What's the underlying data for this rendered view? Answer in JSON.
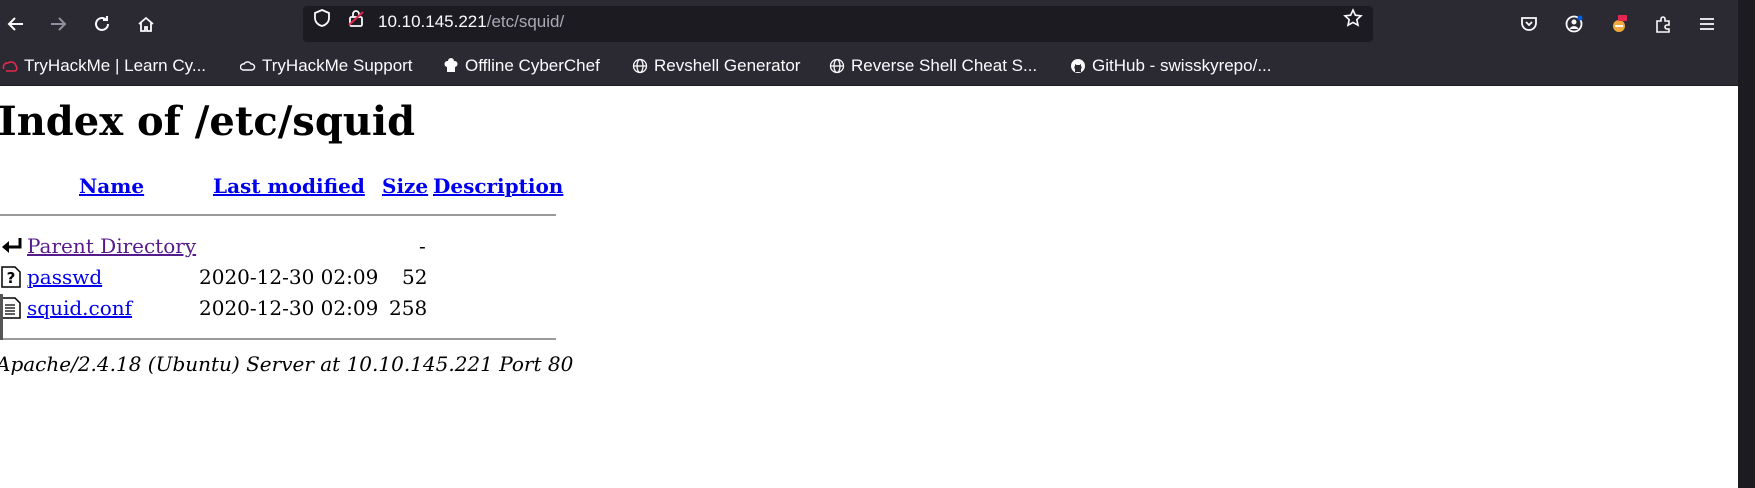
{
  "browser": {
    "url_host": "10.10.145.221",
    "url_path": "/etc/squid/",
    "bookmarks": [
      {
        "label": "TryHackMe | Learn Cy...",
        "icon": "tryhackme-icon"
      },
      {
        "label": "TryHackMe Support",
        "icon": "cloud-icon"
      },
      {
        "label": "Offline CyberChef",
        "icon": "chef-icon"
      },
      {
        "label": "Revshell Generator",
        "icon": "globe-icon"
      },
      {
        "label": "Reverse Shell Cheat S...",
        "icon": "globe-icon"
      },
      {
        "label": "GitHub - swisskyrepo/...",
        "icon": "github-icon"
      }
    ],
    "accent_color": "#0060df"
  },
  "page": {
    "title": "Index of /etc/squid",
    "columns": {
      "name": "Name",
      "last_modified": "Last modified",
      "size": "Size",
      "description": "Description"
    },
    "rows": [
      {
        "icon": "back-arrow-icon",
        "name": "Parent Directory",
        "modified": "",
        "size": "-"
      },
      {
        "icon": "unknown-file-icon",
        "name": "passwd",
        "modified": "2020-12-30 02:09",
        "size": "52"
      },
      {
        "icon": "text-file-icon",
        "name": "squid.conf",
        "modified": "2020-12-30 02:09",
        "size": "258"
      }
    ],
    "footer": "Apache/2.4.18 (Ubuntu) Server at 10.10.145.221 Port 80"
  }
}
